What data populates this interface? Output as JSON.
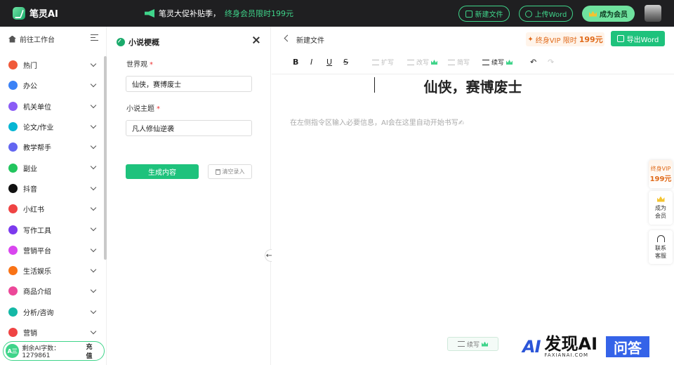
{
  "app": {
    "name": "笔灵AI"
  },
  "promo": {
    "text": "笔灵大促补贴季，",
    "highlight": "终身会员限时199元"
  },
  "top_buttons": {
    "new_file": "新建文件",
    "upload_word": "上传Word",
    "become_member": "成为会员"
  },
  "sidebar": {
    "home_label": "前往工作台",
    "items": [
      {
        "label": "热门",
        "color": "#f05a3a"
      },
      {
        "label": "办公",
        "color": "#3b82f6"
      },
      {
        "label": "机关单位",
        "color": "#8b5cf6"
      },
      {
        "label": "论文/作业",
        "color": "#06b6d4"
      },
      {
        "label": "教学帮手",
        "color": "#6366f1"
      },
      {
        "label": "副业",
        "color": "#22c55e"
      },
      {
        "label": "抖音",
        "color": "#111111"
      },
      {
        "label": "小红书",
        "color": "#ef4444"
      },
      {
        "label": "写作工具",
        "color": "#7c3aed"
      },
      {
        "label": "营销平台",
        "color": "#d946ef"
      },
      {
        "label": "生活娱乐",
        "color": "#f97316"
      },
      {
        "label": "商品介绍",
        "color": "#ec4899"
      },
      {
        "label": "分析/咨询",
        "color": "#14b8a6"
      },
      {
        "label": "营销",
        "color": "#ef4444"
      }
    ],
    "footer": {
      "badge": "A三",
      "text": "剩余AI字数：1279861",
      "charge": "充值"
    }
  },
  "form": {
    "title": "小说梗概",
    "fields": [
      {
        "label": "世界观",
        "value": "仙侠，赛博废士"
      },
      {
        "label": "小说主题",
        "value": "凡人修仙逆袭"
      }
    ],
    "generate": "生成内容",
    "clear": "清空录入"
  },
  "editor": {
    "doc_name": "新建文件",
    "vip_promo": {
      "text": "终身VIP 限时",
      "price": "199元"
    },
    "export": "导出Word",
    "toolbar": {
      "bold": "B",
      "italic": "I",
      "underline": "U",
      "strike": "S",
      "expand": "扩写",
      "rewrite": "改写",
      "simplify": "简写",
      "continue": "续写",
      "undo": "↶",
      "redo": "↷"
    },
    "heading": "仙侠，赛博废士",
    "placeholder": "在左侧指令区输入必要信息，AI会在这里自动开始书写✍",
    "continue_chip": "续写"
  },
  "float_panel": {
    "vip_line1": "终身VIP",
    "vip_line2": "199元",
    "member_a": "成为",
    "member_b": "会员",
    "service_a": "联系",
    "service_b": "客服"
  },
  "watermark": {
    "ai": "AI",
    "big": "发现AI",
    "small": "FAXIANAI.COM",
    "box": "问答"
  },
  "colors": {
    "accent": "#1ec27c",
    "topbar": "#1f1f21",
    "vip_orange": "#e06a1a"
  }
}
